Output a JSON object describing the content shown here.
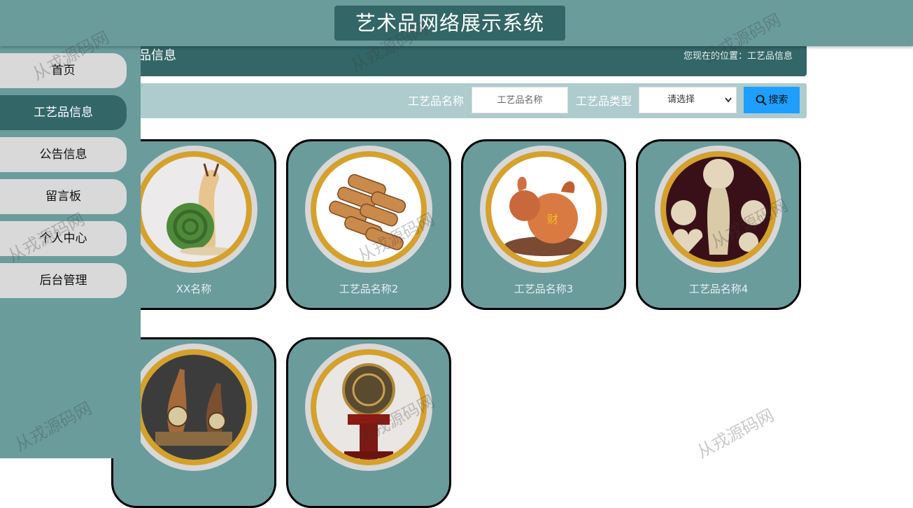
{
  "header": {
    "title": "艺术品网络展示系统"
  },
  "breadcrumb": {
    "section_title": "艺品信息",
    "location": "您现在的位置：工艺品信息"
  },
  "search": {
    "name_label": "工艺品名称",
    "name_placeholder": "工艺品名称",
    "type_label": "工艺品类型",
    "type_selected": "请选择",
    "button_label": "搜索"
  },
  "sidebar": {
    "items": [
      {
        "label": "首页"
      },
      {
        "label": "工艺品信息",
        "active": true
      },
      {
        "label": "公告信息"
      },
      {
        "label": "留言板"
      },
      {
        "label": "个人中心"
      },
      {
        "label": "后台管理"
      }
    ]
  },
  "cards": [
    {
      "name": "XX名称"
    },
    {
      "name": "工艺品名称2"
    },
    {
      "name": "工艺品名称3"
    },
    {
      "name": "工艺品名称4"
    },
    {
      "name": ""
    },
    {
      "name": ""
    }
  ],
  "watermark": {
    "text": "从戎源码网"
  },
  "colors": {
    "primary": "#336666",
    "secondary": "#6a9c9c",
    "gold": "#d4a12c",
    "search_button": "#1e9fff"
  }
}
